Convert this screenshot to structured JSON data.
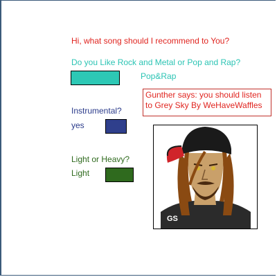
{
  "greeting": "Hi, what song should I recommend to You?",
  "question_genre": "Do you Like Rock and Metal or Pop and Rap?",
  "genre_choice": "Pop&Rap",
  "result_text": "Gunther says: you should listen to Grey Sky By WeHaveWaffles",
  "question_instrumental": "Instrumental?",
  "instrumental_choice": "yes",
  "question_weight": "Light or Heavy?",
  "weight_choice": "Light",
  "avatar_initials": "GS",
  "colors": {
    "greeting": "#e0241f",
    "genre": "#2cc4b4",
    "instrumental": "#2a3a8a",
    "weight": "#2f6a1e"
  }
}
